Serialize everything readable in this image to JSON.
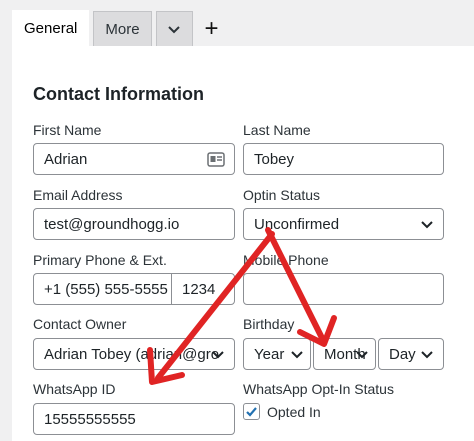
{
  "tabs": [
    {
      "label": "General"
    },
    {
      "label": "More"
    }
  ],
  "icons": {
    "dropdown_tab": "chevron-down-icon",
    "add_tab": "plus-icon",
    "contact_card": "contact-card-icon",
    "checkbox": "checkmark-icon"
  },
  "plus_label": "+",
  "section_title": "Contact Information",
  "fields": {
    "first_name": {
      "label": "First Name",
      "value": "Adrian"
    },
    "last_name": {
      "label": "Last Name",
      "value": "Tobey"
    },
    "email": {
      "label": "Email Address",
      "value": "test@groundhogg.io"
    },
    "optin_status": {
      "label": "Optin Status",
      "value": "Unconfirmed"
    },
    "phone": {
      "label": "Primary Phone & Ext.",
      "value": "+1 (555) 555-5555",
      "ext": "1234"
    },
    "mobile": {
      "label": "Mobile Phone",
      "value": ""
    },
    "owner": {
      "label": "Contact Owner",
      "value": "Adrian Tobey (adrian@gro"
    },
    "birthday": {
      "label": "Birthday",
      "year": "Year",
      "month": "Month",
      "day": "Day"
    },
    "whatsapp_id": {
      "label": "WhatsApp ID",
      "value": "15555555555"
    },
    "whatsapp_optin": {
      "label": "WhatsApp Opt-In Status",
      "checkbox_label": "Opted In",
      "checked": true
    }
  },
  "colors": {
    "annotation_red": "#e02424",
    "checkbox_blue": "#2271b1"
  }
}
